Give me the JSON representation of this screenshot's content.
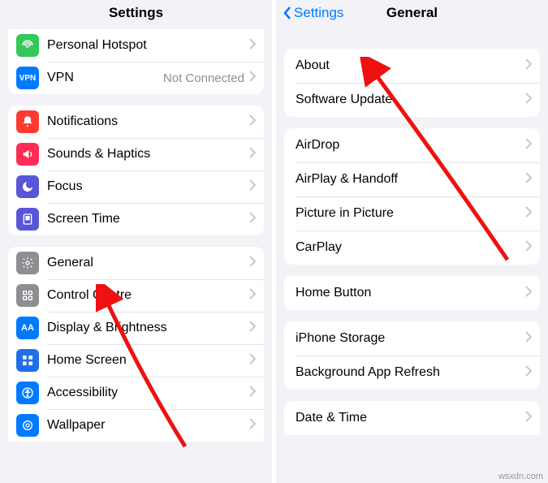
{
  "left": {
    "title": "Settings",
    "groups": [
      [
        {
          "icon": "hotspot-icon",
          "bg": "bg-green",
          "label": "Personal Hotspot",
          "detail": ""
        },
        {
          "icon": "vpn-icon",
          "bg": "bg-blue",
          "label": "VPN",
          "detail": "Not Connected"
        }
      ],
      [
        {
          "icon": "notifications-icon",
          "bg": "bg-red",
          "label": "Notifications"
        },
        {
          "icon": "sounds-icon",
          "bg": "bg-pink",
          "label": "Sounds & Haptics"
        },
        {
          "icon": "focus-icon",
          "bg": "bg-indigo",
          "label": "Focus"
        },
        {
          "icon": "screentime-icon",
          "bg": "bg-indigo",
          "label": "Screen Time"
        }
      ],
      [
        {
          "icon": "general-icon",
          "bg": "bg-gray",
          "label": "General"
        },
        {
          "icon": "control-centre-icon",
          "bg": "bg-gray",
          "label": "Control Centre"
        },
        {
          "icon": "display-icon",
          "bg": "bg-blue2",
          "label": "Display & Brightness"
        },
        {
          "icon": "homescreen-icon",
          "bg": "bg-blue3",
          "label": "Home Screen"
        },
        {
          "icon": "accessibility-icon",
          "bg": "bg-blue2",
          "label": "Accessibility"
        },
        {
          "icon": "wallpaper-icon",
          "bg": "bg-blue2",
          "label": "Wallpaper"
        }
      ]
    ]
  },
  "right": {
    "back": "Settings",
    "title": "General",
    "groups": [
      [
        {
          "label": "About"
        },
        {
          "label": "Software Update"
        }
      ],
      [
        {
          "label": "AirDrop"
        },
        {
          "label": "AirPlay & Handoff"
        },
        {
          "label": "Picture in Picture"
        },
        {
          "label": "CarPlay"
        }
      ],
      [
        {
          "label": "Home Button"
        }
      ],
      [
        {
          "label": "iPhone Storage"
        },
        {
          "label": "Background App Refresh"
        }
      ],
      [
        {
          "label": "Date & Time"
        }
      ]
    ]
  },
  "watermark": "wsxdn.com"
}
